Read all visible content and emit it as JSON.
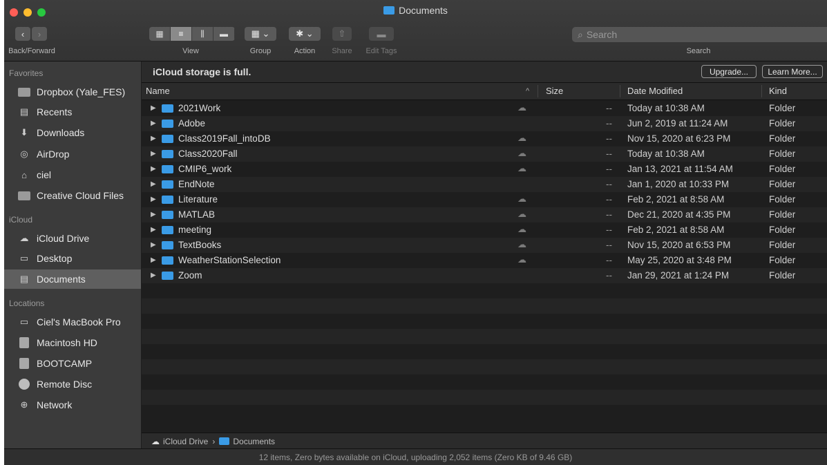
{
  "window": {
    "title": "Documents"
  },
  "toolbar": {
    "back_forward_label": "Back/Forward",
    "view_label": "View",
    "group_label": "Group",
    "action_label": "Action",
    "share_label": "Share",
    "edit_tags_label": "Edit Tags",
    "search_placeholder": "Search",
    "search_label": "Search"
  },
  "sidebar": {
    "favorites_header": "Favorites",
    "favorites": [
      {
        "label": "Dropbox (Yale_FES)",
        "icon": "folder-icon"
      },
      {
        "label": "Recents",
        "icon": "recents-icon"
      },
      {
        "label": "Downloads",
        "icon": "downloads-icon"
      },
      {
        "label": "AirDrop",
        "icon": "airdrop-icon"
      },
      {
        "label": "ciel",
        "icon": "home-icon"
      },
      {
        "label": "Creative Cloud Files",
        "icon": "folder-icon"
      }
    ],
    "icloud_header": "iCloud",
    "icloud": [
      {
        "label": "iCloud Drive",
        "icon": "cloud-icon"
      },
      {
        "label": "Desktop",
        "icon": "desktop-icon"
      },
      {
        "label": "Documents",
        "icon": "documents-icon",
        "selected": true
      }
    ],
    "locations_header": "Locations",
    "locations": [
      {
        "label": "Ciel's MacBook Pro",
        "icon": "laptop-icon"
      },
      {
        "label": "Macintosh HD",
        "icon": "disk-icon"
      },
      {
        "label": "BOOTCAMP",
        "icon": "disk-icon"
      },
      {
        "label": "Remote Disc",
        "icon": "disc-icon"
      },
      {
        "label": "Network",
        "icon": "network-icon"
      }
    ]
  },
  "icloud_bar": {
    "message": "iCloud storage is full.",
    "upgrade_label": "Upgrade...",
    "learn_more_label": "Learn More..."
  },
  "columns": {
    "name": "Name",
    "size": "Size",
    "date": "Date Modified",
    "kind": "Kind",
    "sort_indicator": "^"
  },
  "files": [
    {
      "name": "2021Work",
      "cloud": true,
      "size": "--",
      "date": "Today at 10:38 AM",
      "kind": "Folder"
    },
    {
      "name": "Adobe",
      "cloud": false,
      "size": "--",
      "date": "Jun 2, 2019 at 11:24 AM",
      "kind": "Folder"
    },
    {
      "name": "Class2019Fall_intoDB",
      "cloud": true,
      "size": "--",
      "date": "Nov 15, 2020 at 6:23 PM",
      "kind": "Folder"
    },
    {
      "name": "Class2020Fall",
      "cloud": true,
      "size": "--",
      "date": "Today at 10:38 AM",
      "kind": "Folder"
    },
    {
      "name": "CMIP6_work",
      "cloud": true,
      "size": "--",
      "date": "Jan 13, 2021 at 11:54 AM",
      "kind": "Folder"
    },
    {
      "name": "EndNote",
      "cloud": false,
      "size": "--",
      "date": "Jan 1, 2020 at 10:33 PM",
      "kind": "Folder"
    },
    {
      "name": "Literature",
      "cloud": true,
      "size": "--",
      "date": "Feb 2, 2021 at 8:58 AM",
      "kind": "Folder"
    },
    {
      "name": "MATLAB",
      "cloud": true,
      "size": "--",
      "date": "Dec 21, 2020 at 4:35 PM",
      "kind": "Folder"
    },
    {
      "name": "meeting",
      "cloud": true,
      "size": "--",
      "date": "Feb 2, 2021 at 8:58 AM",
      "kind": "Folder"
    },
    {
      "name": "TextBooks",
      "cloud": true,
      "size": "--",
      "date": "Nov 15, 2020 at 6:53 PM",
      "kind": "Folder"
    },
    {
      "name": "WeatherStationSelection",
      "cloud": true,
      "size": "--",
      "date": "May 25, 2020 at 3:48 PM",
      "kind": "Folder"
    },
    {
      "name": "Zoom",
      "cloud": false,
      "size": "--",
      "date": "Jan 29, 2021 at 1:24 PM",
      "kind": "Folder"
    }
  ],
  "pathbar": {
    "root": "iCloud Drive",
    "separator": "›",
    "current": "Documents"
  },
  "status": "12 items, Zero bytes available on iCloud, uploading 2,052 items (Zero KB of 9.46 GB)",
  "colors": {
    "folder_blue": "#3a9be6",
    "sidebar_bg": "#3b3b3b",
    "content_bg": "#1e1e1e"
  }
}
